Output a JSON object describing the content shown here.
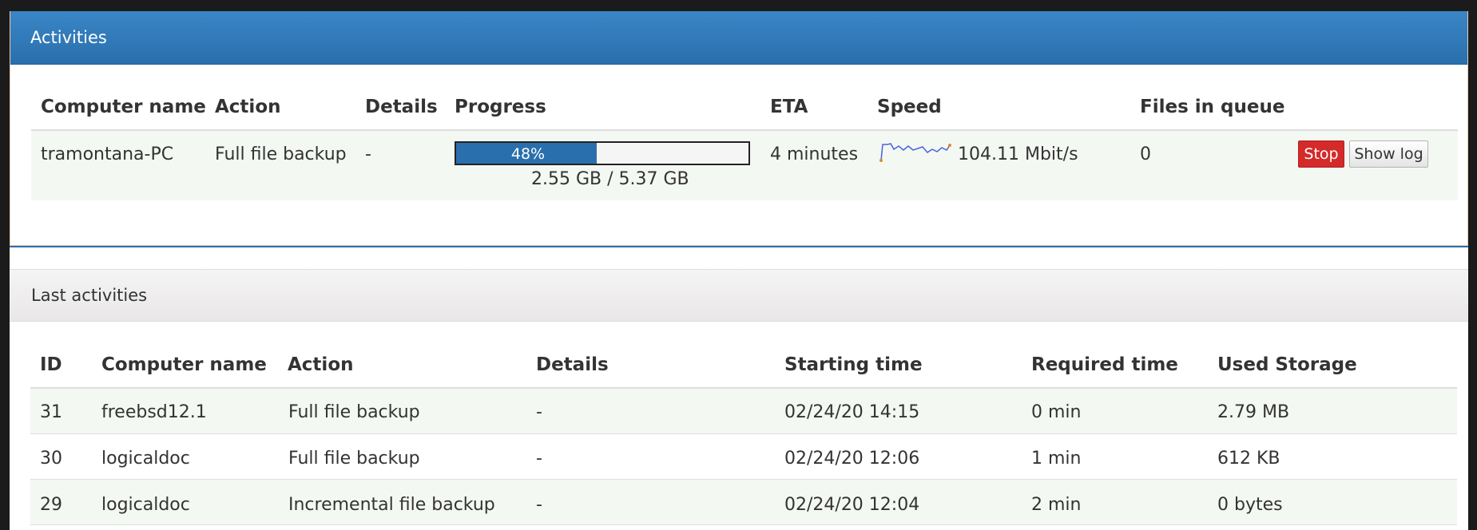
{
  "activities": {
    "title": "Activities",
    "headers": {
      "computer_name": "Computer name",
      "action": "Action",
      "details": "Details",
      "progress": "Progress",
      "eta": "ETA",
      "speed": "Speed",
      "files_in_queue": "Files in queue"
    },
    "row": {
      "computer_name": "tramontana-PC",
      "action": "Full file backup",
      "details": "-",
      "progress_percent": 48,
      "progress_label": "48%",
      "progress_size": "2.55 GB / 5.37 GB",
      "eta": "4 minutes",
      "speed": "104.11 Mbit/s",
      "files_in_queue": "0",
      "stop_label": "Stop",
      "show_log_label": "Show log"
    }
  },
  "last_activities": {
    "title": "Last activities",
    "headers": {
      "id": "ID",
      "computer_name": "Computer name",
      "action": "Action",
      "details": "Details",
      "starting_time": "Starting time",
      "required_time": "Required time",
      "used_storage": "Used Storage"
    },
    "rows": [
      {
        "id": "31",
        "computer_name": "freebsd12.1",
        "action": "Full file backup",
        "details": "-",
        "starting_time": "02/24/20 14:15",
        "required_time": "0 min",
        "used_storage": "2.79 MB"
      },
      {
        "id": "30",
        "computer_name": "logicaldoc",
        "action": "Full file backup",
        "details": "-",
        "starting_time": "02/24/20 12:06",
        "required_time": "1 min",
        "used_storage": "612 KB"
      },
      {
        "id": "29",
        "computer_name": "logicaldoc",
        "action": "Incremental file backup",
        "details": "-",
        "starting_time": "02/24/20 12:04",
        "required_time": "2 min",
        "used_storage": "0 bytes"
      }
    ]
  },
  "colors": {
    "header_blue": "#2a6fad",
    "stop_red": "#d42a2a",
    "row_tint": "#f4f8f3"
  },
  "icons": {
    "speed_graph": "sparkline-icon"
  }
}
